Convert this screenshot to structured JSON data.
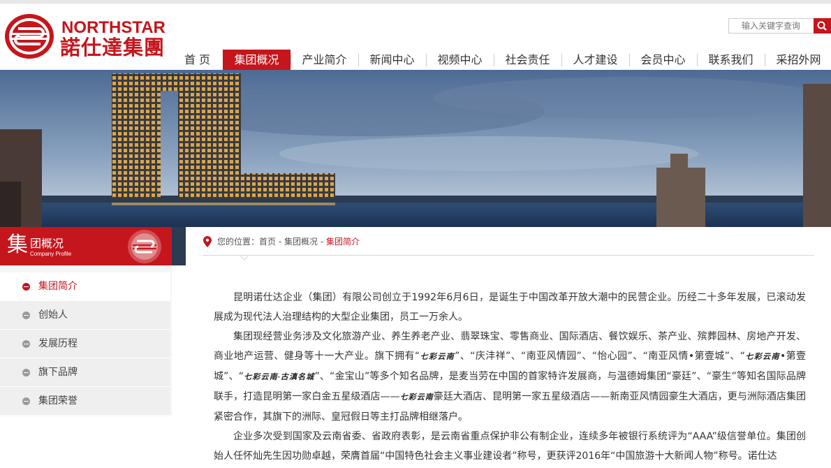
{
  "header": {
    "logo_en": "NORTHSTAR",
    "logo_cn": "諾仕達集團",
    "search_placeholder": "输入关键字查询"
  },
  "nav": {
    "items": [
      "首 页",
      "集团概况",
      "产业简介",
      "新闻中心",
      "视频中心",
      "社会责任",
      "人才建设",
      "会员中心",
      "联系我们",
      "采招外网"
    ],
    "active_index": 1
  },
  "sidebar": {
    "title_big": "集",
    "title_cn": "团概况",
    "title_en": "Company Profile",
    "items": [
      "集团简介",
      "创始人",
      "发展历程",
      "旗下品牌",
      "集团荣誉"
    ],
    "active_index": 0
  },
  "breadcrumb": {
    "prefix": "您的位置：",
    "home": "首页",
    "sep": " - ",
    "section": "集团概况",
    "current": "集团简介"
  },
  "article": {
    "p1": "昆明诺仕达企业（集团）有限公司创立于1992年6月6日，是诞生于中国改革开放大潮中的民营企业。历经二十多年发展，已滚动发展成为现代法人治理结构的大型企业集团，员工一万余人。",
    "p2a": "集团现经营业务涉及文化旅游产业、养生养老产业、翡翠珠宝、零售商业、国际酒店、餐饮娱乐、茶产业、殡葬园林、房地产开发、商业地产运营、健身等十一大产业。旗下拥有“",
    "brand1": "七彩云南",
    "p2b": "”、“庆沣祥”、“南亚风情园”、“怡心园”、“南亚风情•第壹城”、“",
    "brand2": "七彩云南",
    "p2c": "•第壹城”、“",
    "brand3": "七彩云南·古滇名城",
    "p2d": "”、“金宝山”等多个知名品牌，是麦当劳在中国的首家特许发展商，与温德姆集团“豪廷”、“豪生”等知名国际品牌联手，打造昆明第一家白金五星级酒店——",
    "brand4": "七彩云南",
    "p2e": "豪廷大酒店、昆明第一家五星级酒店——新南亚风情园豪生大酒店，更与洲际酒店集团紧密合作，其旗下的洲际、皇冠假日等主打品牌相继落户。",
    "p3": "企业多次受到国家及云南省委、省政府表彰，是云南省重点保护非公有制企业，连续多年被银行系统评为“AAA”级信誉单位。集团创始人任怀灿先生因功勋卓越，荣膺首届“中国特色社会主义事业建设者”称号，更获评2016年“中国旅游十大新闻人物”称号。诺仕达"
  },
  "colors": {
    "brand_red": "#c4161c",
    "sidebar_strip": "#2a3b52"
  }
}
